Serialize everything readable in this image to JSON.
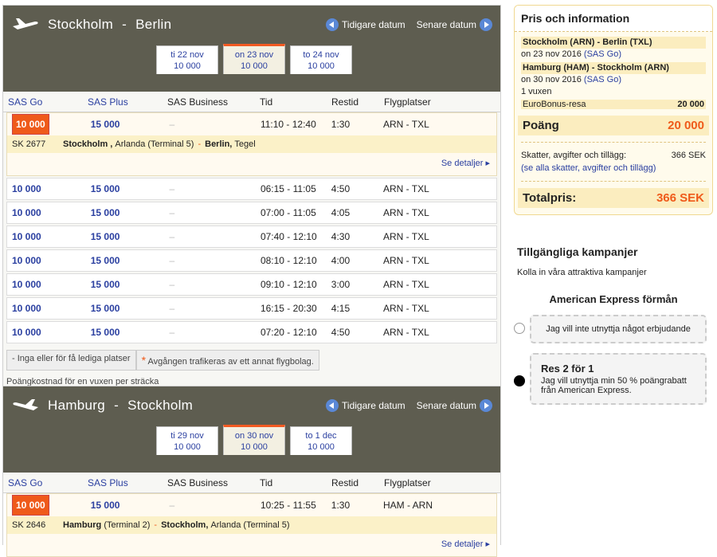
{
  "nav": {
    "prev": "Tidigare datum",
    "next": "Senare datum"
  },
  "columns": [
    "SAS Go",
    "SAS Plus",
    "SAS Business",
    "Tid",
    "Restid",
    "Flygplatser"
  ],
  "outbound": {
    "route_from": "Stockholm",
    "route_sep": "-",
    "route_to": "Berlin",
    "tabs": [
      {
        "date": "ti 22 nov",
        "pts": "10 000"
      },
      {
        "date": "on 23 nov",
        "pts": "10 000"
      },
      {
        "date": "to 24 nov",
        "pts": "10 000"
      }
    ],
    "selected": {
      "go": "10 000",
      "plus": "15 000",
      "business": "–",
      "dep": "11:10",
      "arr": "12:40",
      "dur": "1:30",
      "from": "ARN",
      "to": "TXL",
      "flight": "SK 2677",
      "d_city": "Stockholm ,",
      "d_airport": "Arlanda (Terminal 5)",
      "a_city": "Berlin,",
      "a_airport": "Tegel",
      "details": "Se detaljer"
    },
    "rows": [
      {
        "go": "10 000",
        "plus": "15 000",
        "business": "–",
        "dep": "06:15",
        "arr": "11:05",
        "dur": "4:50",
        "from": "ARN",
        "to": "TXL"
      },
      {
        "go": "10 000",
        "plus": "15 000",
        "business": "–",
        "dep": "07:00",
        "arr": "11:05",
        "dur": "4:05",
        "from": "ARN",
        "to": "TXL"
      },
      {
        "go": "10 000",
        "plus": "15 000",
        "business": "–",
        "dep": "07:40",
        "arr": "12:10",
        "dur": "4:30",
        "from": "ARN",
        "to": "TXL"
      },
      {
        "go": "10 000",
        "plus": "15 000",
        "business": "–",
        "dep": "08:10",
        "arr": "12:10",
        "dur": "4:00",
        "from": "ARN",
        "to": "TXL"
      },
      {
        "go": "10 000",
        "plus": "15 000",
        "business": "–",
        "dep": "09:10",
        "arr": "12:10",
        "dur": "3:00",
        "from": "ARN",
        "to": "TXL"
      },
      {
        "go": "10 000",
        "plus": "15 000",
        "business": "–",
        "dep": "16:15",
        "arr": "20:30",
        "dur": "4:15",
        "from": "ARN",
        "to": "TXL"
      },
      {
        "go": "10 000",
        "plus": "15 000",
        "business": "–",
        "dep": "07:20",
        "arr": "12:10",
        "dur": "4:50",
        "from": "ARN",
        "to": "TXL"
      }
    ],
    "legend_none": "- Inga eller för få lediga platser",
    "legend_star": "*",
    "legend_other": "Avgången trafikeras av ett annat flygbolag.",
    "footnote": "Poängkostnad för en vuxen per sträcka"
  },
  "inbound": {
    "route_from": "Hamburg",
    "route_sep": "-",
    "route_to": "Stockholm",
    "tabs": [
      {
        "date": "ti 29 nov",
        "pts": "10 000"
      },
      {
        "date": "on 30 nov",
        "pts": "10 000"
      },
      {
        "date": "to 1 dec",
        "pts": "10 000"
      }
    ],
    "selected": {
      "go": "10 000",
      "plus": "15 000",
      "business": "–",
      "dep": "10:25",
      "arr": "11:55",
      "dur": "1:30",
      "from": "HAM",
      "to": "ARN",
      "flight": "SK 2646",
      "d_city": "Hamburg",
      "d_airport": "(Terminal 2)",
      "a_city": "Stockholm,",
      "a_airport": "Arlanda  (Terminal 5)",
      "details": "Se detaljer"
    }
  },
  "info": {
    "title": "Pris och information",
    "leg1_title": "Stockholm (ARN) - Berlin (TXL)",
    "leg1_date": "on 23 nov 2016",
    "leg1_fare": "(SAS Go)",
    "leg2_title": "Hamburg (HAM) - Stockholm (ARN)",
    "leg2_date": "on 30 nov 2016",
    "leg2_fare": "(SAS Go)",
    "pax": "1 vuxen",
    "eb_label": "EuroBonus-resa",
    "eb_value": "20 000",
    "points_label": "Poäng",
    "points_value": "20 000",
    "tax_label": "Skatter, avgifter och tillägg:",
    "tax_value": "366  SEK",
    "tax_link": "(se alla skatter, avgifter och tillägg)",
    "total_label": "Totalpris:",
    "total_value": "366  SEK"
  },
  "campaigns": {
    "title": "Tillgängliga kampanjer",
    "subtitle": "Kolla in våra attraktiva kampanjer",
    "amex_title": "American Express förmån",
    "opt1": "Jag vill inte utnyttja något erbjudande",
    "opt2_title": "Res 2 för 1",
    "opt2_text": "Jag vill utnyttja min 50 % poängrabatt från American Express."
  }
}
